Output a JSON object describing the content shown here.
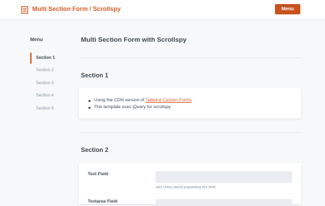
{
  "header": {
    "icon": "form-icon",
    "title": "Multi Section Form / Scrollspy",
    "menu_label": "Menu"
  },
  "sidebar": {
    "heading": "Menu",
    "items": [
      {
        "label": "Section 1",
        "active": true
      },
      {
        "label": "Section 2",
        "active": false
      },
      {
        "label": "Section 3",
        "active": false
      },
      {
        "label": "Section 4",
        "active": false
      },
      {
        "label": "Section 5",
        "active": false
      }
    ]
  },
  "main": {
    "page_title": "Multi Section Form with Scrollspy",
    "section1": {
      "heading": "Section 1",
      "bullet1_prefix": "Using the CDN version of ",
      "bullet1_link": "Tailwind Custom Forms",
      "bullet2": "This template uses jQuery for scrollspy"
    },
    "section2": {
      "heading": "Section 2",
      "text_field_label": "Text Field",
      "text_field_value": "",
      "text_field_help": "add notes about populating the field",
      "next_field_label_partial": "Textarea Field"
    }
  },
  "colors": {
    "accent": "#d55b28",
    "button": "#c8521e",
    "background": "#f7f8fa"
  }
}
